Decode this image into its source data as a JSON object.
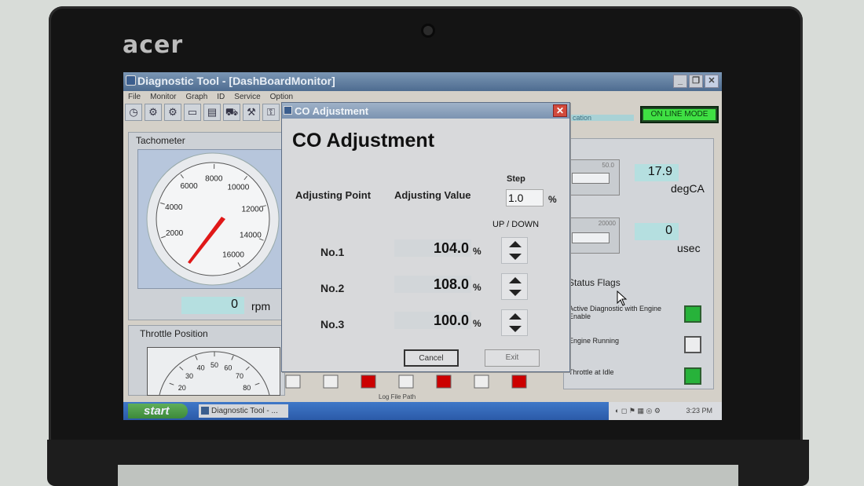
{
  "device": {
    "logo": "acer"
  },
  "window": {
    "title": "Diagnostic Tool - [DashBoardMonitor]",
    "menu": [
      "File",
      "Monitor",
      "Graph",
      "ID",
      "Service",
      "Option"
    ],
    "status": "ON LINE MODE",
    "status_partial": "cation"
  },
  "tachometer": {
    "title": "Tachometer",
    "value": "0",
    "unit": "rpm",
    "ticks": [
      "2000",
      "4000",
      "6000",
      "8000",
      "10000",
      "12000",
      "14000",
      "16000"
    ]
  },
  "throttle": {
    "title": "Throttle Position",
    "ticks": [
      "20",
      "30",
      "40",
      "50",
      "60",
      "70",
      "80"
    ]
  },
  "right_panel": {
    "gauge1": {
      "max": "50.0",
      "value": "17.9",
      "unit": "degCA"
    },
    "gauge2": {
      "max": "20000",
      "value": "0",
      "unit": "usec"
    }
  },
  "status_flags": {
    "title": "Status Flags",
    "items": [
      {
        "label": "Active Diagnostic with Engine Enable",
        "on": true
      },
      {
        "label": "Engine Running",
        "on": false
      },
      {
        "label": "Throttle at Idle",
        "on": true
      }
    ]
  },
  "dialog": {
    "title": "CO Adjustment",
    "heading": "CO Adjustment",
    "col_point": "Adjusting Point",
    "col_value": "Adjusting Value",
    "step_label": "Step",
    "step_value": "1.0",
    "step_unit": "%",
    "updown_label": "UP / DOWN",
    "rows": [
      {
        "label": "No.1",
        "value": "104.0",
        "unit": "%"
      },
      {
        "label": "No.2",
        "value": "108.0",
        "unit": "%"
      },
      {
        "label": "No.3",
        "value": "100.0",
        "unit": "%"
      }
    ],
    "cancel_label": "Cancel",
    "exit_label": "Exit"
  },
  "bottom": {
    "log_file_path": "Log File Path"
  },
  "taskbar": {
    "start_label": "start",
    "task_label": "Diagnostic Tool - ...",
    "clock": "3:23 PM"
  }
}
